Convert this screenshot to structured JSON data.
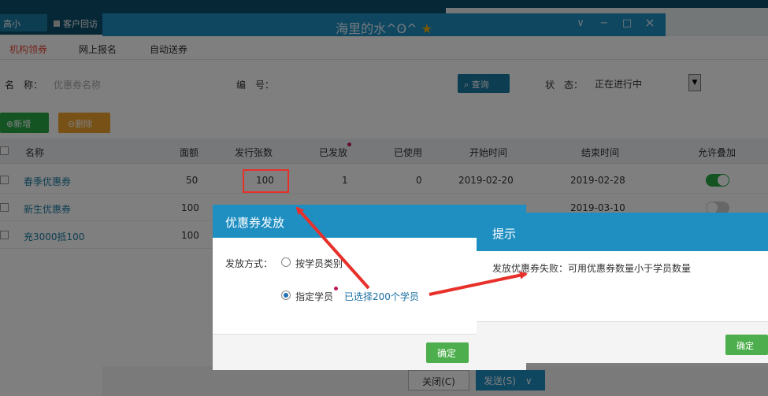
{
  "topbar": {
    "tab_a": "高小",
    "tab_b": "客户回访"
  },
  "window": {
    "title": "海里的水^ʘ^",
    "star": "★",
    "min": "∨",
    "restore": "−",
    "max": "□",
    "close": "×"
  },
  "subtabs": [
    "机构领券",
    "网上报名",
    "自动送券"
  ],
  "search": {
    "name_label": "名　称：",
    "name_placeholder": "优惠券名称",
    "code_label": "编　号：",
    "button": "查询",
    "status_label": "状　态：",
    "status_value": "正在进行中"
  },
  "actions": {
    "add": "新增",
    "delete": "删除"
  },
  "table": {
    "headers": [
      "名称",
      "面额",
      "发行张数",
      "已发放",
      "已使用",
      "开始时间",
      "结束时间",
      "允许叠加"
    ],
    "rows": [
      {
        "name": "春季优惠券",
        "value": "50",
        "issued": "100",
        "sent": "1",
        "used": "0",
        "start": "2019-02-20",
        "end": "2019-02-28",
        "stack": true
      },
      {
        "name": "新生优惠券",
        "value": "100",
        "issued": "",
        "sent": "",
        "used": "",
        "start": "",
        "end": "2019-03-10",
        "stack": false
      },
      {
        "name": "充3000抵100",
        "value": "100",
        "issued": "",
        "sent": "",
        "used": "",
        "start": "",
        "end": "",
        "stack": false
      }
    ]
  },
  "bottom": {
    "close": "关闭(C)",
    "send": "发送(S)",
    "send_arrow": "∨"
  },
  "dialog": {
    "title": "优惠券发放",
    "method_label": "发放方式：",
    "option1": "按学员类别",
    "option2": "指定学员",
    "selected_info": "已选择200个学员",
    "ok": "确定"
  },
  "alert": {
    "title": "提示",
    "message": "发放优惠券失败：可用优惠券数量小于学员数量",
    "ok": "确定"
  },
  "colors": {
    "accent": "#1f8fc2",
    "arrow": "#e8302a",
    "ok_green": "#4cae4c"
  }
}
